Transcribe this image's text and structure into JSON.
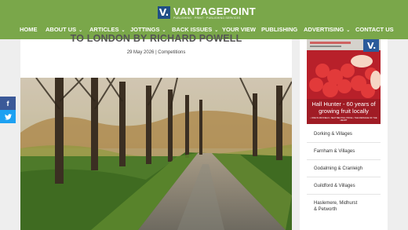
{
  "brand": {
    "logo_letter": "V.",
    "name": "VANTAGEPOINT",
    "tagline": "PUBLISHING · PRINT · PUBLISHING SERVICES",
    "header_color": "#7aa74a",
    "badge_color": "#1f4f86"
  },
  "nav": {
    "items": [
      {
        "label": "HOME",
        "has_dropdown": false
      },
      {
        "label": "ABOUT US",
        "has_dropdown": true
      },
      {
        "label": "ARTICLES",
        "has_dropdown": true
      },
      {
        "label": "JOTTINGS",
        "has_dropdown": true
      },
      {
        "label": "BACK ISSUES",
        "has_dropdown": true
      },
      {
        "label": "YOUR VIEW",
        "has_dropdown": false
      },
      {
        "label": "PUBLISHING",
        "has_dropdown": false
      },
      {
        "label": "ADVERTISING",
        "has_dropdown": true
      },
      {
        "label": "CONTACT US",
        "has_dropdown": false
      }
    ],
    "dropdown_icon": "chevron-down-icon"
  },
  "post": {
    "title": "TO LONDON BY RICHARD POWELL",
    "date": "29 May 2026",
    "separator": "|",
    "category": "Competitions"
  },
  "share": {
    "facebook_icon": "facebook-icon",
    "twitter_icon": "twitter-icon",
    "facebook_color": "#3b5998",
    "twitter_color": "#1da1f2"
  },
  "sidebar": {
    "cover": {
      "caption_line1": "Hall Hunter - 60 years of",
      "caption_line2": "growing fruit locally",
      "fine_print": "• ODE IN MAYFIELD • SEAT BELTING: PRICE • THE MESSAGE OF THE HEART"
    },
    "categories": [
      {
        "label": "Dorking & Villages"
      },
      {
        "label": "Farnham & Villages"
      },
      {
        "label": "Godalming & Cranleigh"
      },
      {
        "label": "Guildford & Villages"
      },
      {
        "label": "Haslemere, Midhurst & Petworth"
      }
    ]
  }
}
